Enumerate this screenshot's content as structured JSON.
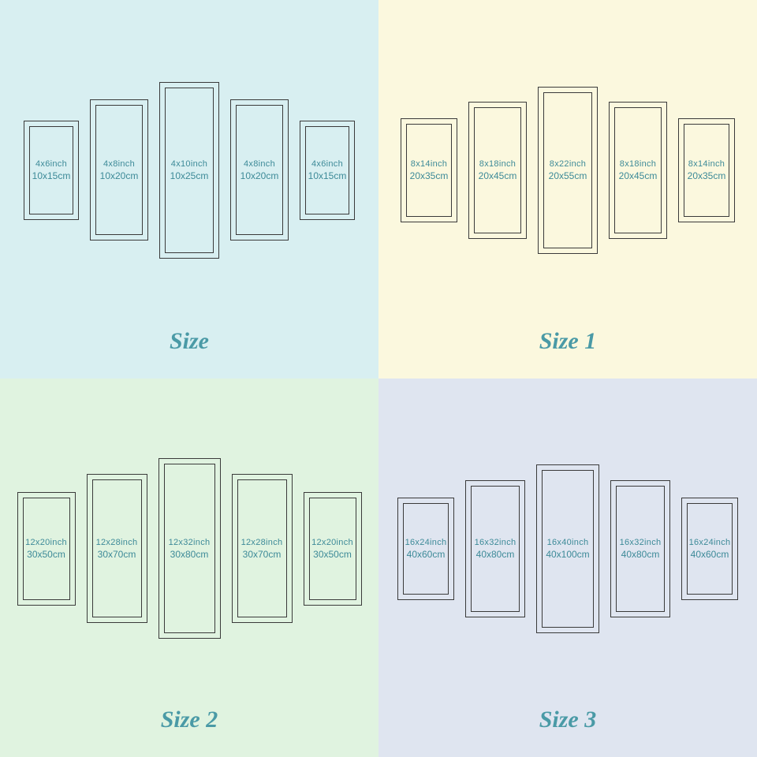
{
  "quadrants": [
    {
      "title": "Size",
      "bg": "q0",
      "scale": "scale-1",
      "panels": [
        {
          "inch": "4x6inch",
          "cm": "10x15cm",
          "size": "s-small"
        },
        {
          "inch": "4x8inch",
          "cm": "10x20cm",
          "size": "s-med"
        },
        {
          "inch": "4x10inch",
          "cm": "10x25cm",
          "size": "s-large"
        },
        {
          "inch": "4x8inch",
          "cm": "10x20cm",
          "size": "s-med"
        },
        {
          "inch": "4x6inch",
          "cm": "10x15cm",
          "size": "s-small"
        }
      ]
    },
    {
      "title": "Size 1",
      "bg": "q1",
      "scale": "scale-2",
      "panels": [
        {
          "inch": "8x14inch",
          "cm": "20x35cm",
          "size": "s-small"
        },
        {
          "inch": "8x18inch",
          "cm": "20x45cm",
          "size": "s-med"
        },
        {
          "inch": "8x22inch",
          "cm": "20x55cm",
          "size": "s-large"
        },
        {
          "inch": "8x18inch",
          "cm": "20x45cm",
          "size": "s-med"
        },
        {
          "inch": "8x14inch",
          "cm": "20x35cm",
          "size": "s-small"
        }
      ]
    },
    {
      "title": "Size 2",
      "bg": "q2",
      "scale": "scale-3",
      "panels": [
        {
          "inch": "12x20inch",
          "cm": "30x50cm",
          "size": "s-small"
        },
        {
          "inch": "12x28inch",
          "cm": "30x70cm",
          "size": "s-med"
        },
        {
          "inch": "12x32inch",
          "cm": "30x80cm",
          "size": "s-large"
        },
        {
          "inch": "12x28inch",
          "cm": "30x70cm",
          "size": "s-med"
        },
        {
          "inch": "12x20inch",
          "cm": "30x50cm",
          "size": "s-small"
        }
      ]
    },
    {
      "title": "Size 3",
      "bg": "q3",
      "scale": "scale-4",
      "panels": [
        {
          "inch": "16x24inch",
          "cm": "40x60cm",
          "size": "s-small"
        },
        {
          "inch": "16x32inch",
          "cm": "40x80cm",
          "size": "s-med"
        },
        {
          "inch": "16x40inch",
          "cm": "40x100cm",
          "size": "s-large"
        },
        {
          "inch": "16x32inch",
          "cm": "40x80cm",
          "size": "s-med"
        },
        {
          "inch": "16x24inch",
          "cm": "40x60cm",
          "size": "s-small"
        }
      ]
    }
  ]
}
